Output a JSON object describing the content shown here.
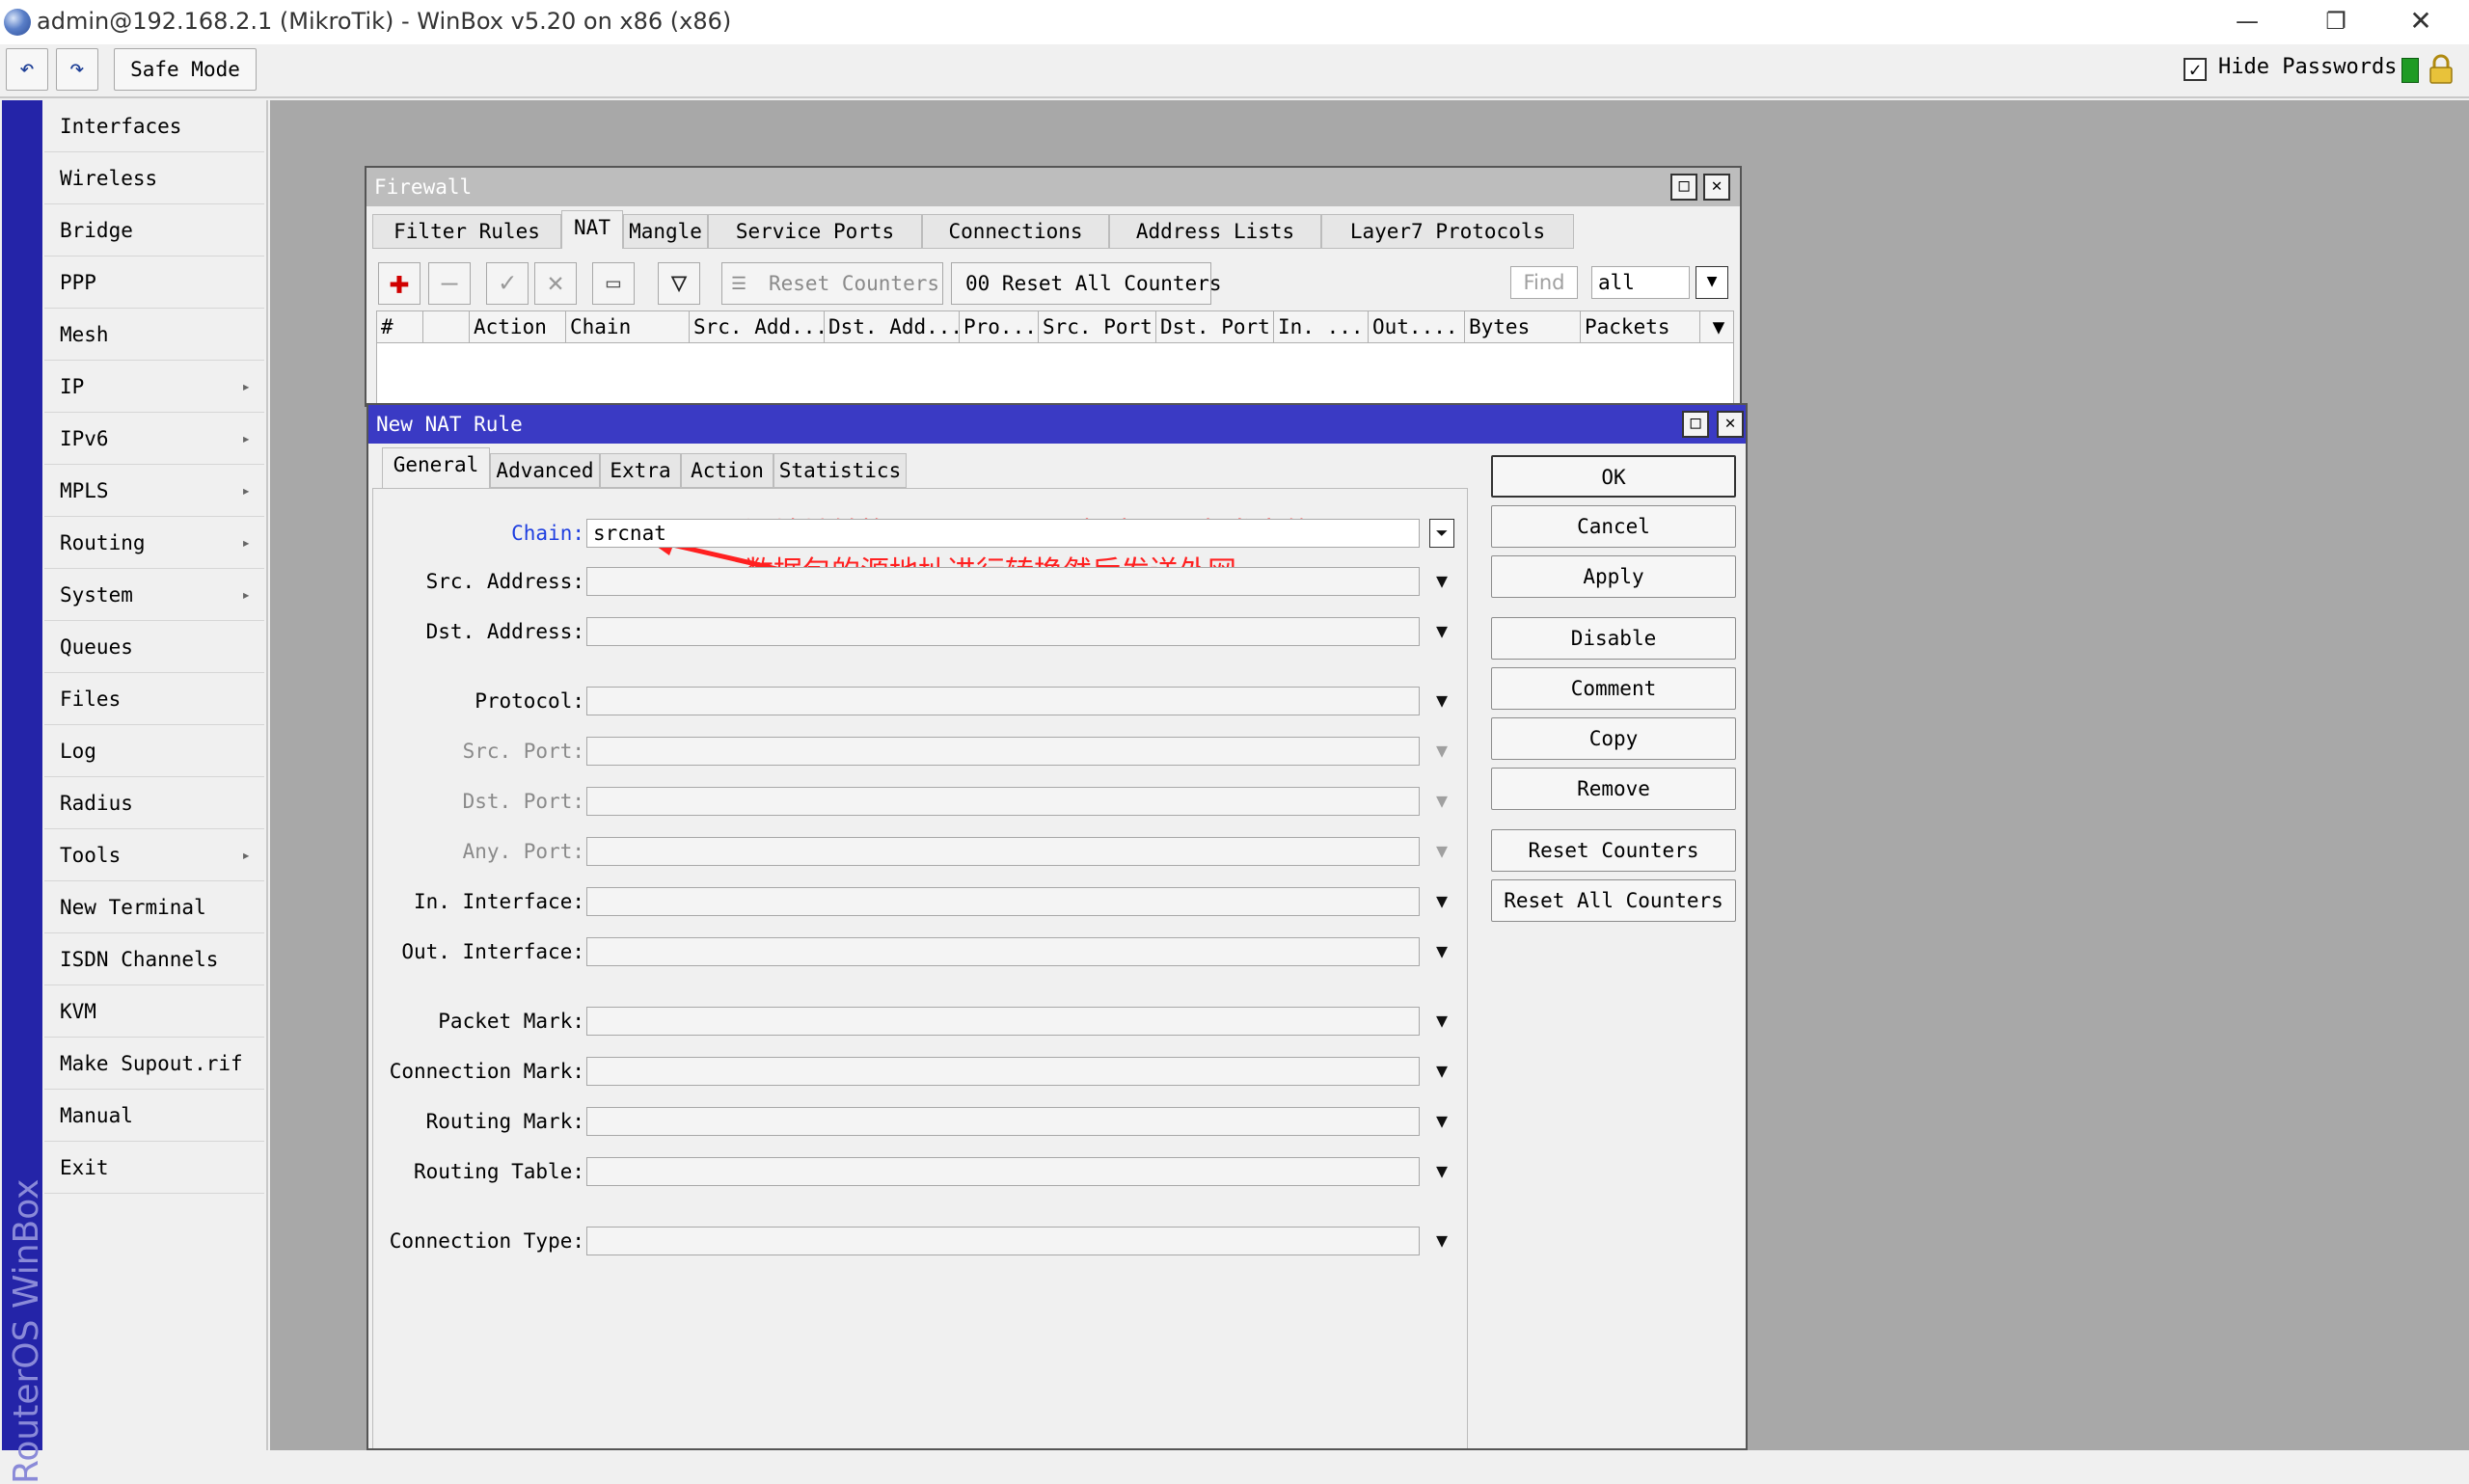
{
  "window": {
    "title": "admin@192.168.2.1 (MikroTik) - WinBox v5.20 on x86 (x86)",
    "minimize_glyph": "—",
    "maximize_glyph": "❐",
    "close_glyph": "✕"
  },
  "toolbar": {
    "undo_icon": "undo-icon",
    "redo_icon": "redo-icon",
    "undo_glyph": "↶",
    "redo_glyph": "↷",
    "safe_mode_label": "Safe Mode",
    "hide_passwords_label": "Hide Passwords",
    "hide_passwords_checked": true,
    "hide_passwords_glyph": "✓"
  },
  "brand": {
    "text": "RouterOS WinBox"
  },
  "menu": {
    "items": [
      {
        "label": "Interfaces",
        "submenu": false
      },
      {
        "label": "Wireless",
        "submenu": false
      },
      {
        "label": "Bridge",
        "submenu": false
      },
      {
        "label": "PPP",
        "submenu": false
      },
      {
        "label": "Mesh",
        "submenu": false
      },
      {
        "label": "IP",
        "submenu": true
      },
      {
        "label": "IPv6",
        "submenu": true
      },
      {
        "label": "MPLS",
        "submenu": true
      },
      {
        "label": "Routing",
        "submenu": true
      },
      {
        "label": "System",
        "submenu": true
      },
      {
        "label": "Queues",
        "submenu": false
      },
      {
        "label": "Files",
        "submenu": false
      },
      {
        "label": "Log",
        "submenu": false
      },
      {
        "label": "Radius",
        "submenu": false
      },
      {
        "label": "Tools",
        "submenu": true
      },
      {
        "label": "New Terminal",
        "submenu": false
      },
      {
        "label": "ISDN Channels",
        "submenu": false
      },
      {
        "label": "KVM",
        "submenu": false
      },
      {
        "label": "Make Supout.rif",
        "submenu": false
      },
      {
        "label": "Manual",
        "submenu": false
      },
      {
        "label": "Exit",
        "submenu": false
      }
    ],
    "submenu_glyph": "▸"
  },
  "firewall": {
    "title": "Firewall",
    "tabs": [
      "Filter Rules",
      "NAT",
      "Mangle",
      "Service Ports",
      "Connections",
      "Address Lists",
      "Layer7 Protocols"
    ],
    "active_tab": "NAT",
    "toolbar": {
      "add_glyph": "✚",
      "remove_glyph": "—",
      "enable_glyph": "✓",
      "disable_glyph": "✕",
      "comment_glyph": "▭",
      "filter_glyph": "▽",
      "reset_counters_icon_glyph": "☰",
      "reset_counters": "Reset Counters",
      "reset_all_counters": "00 Reset All Counters",
      "find_placeholder": "Find",
      "filter_value": "all",
      "filter_drop_glyph": "▼"
    },
    "columns": [
      "#",
      "",
      "Action",
      "Chain",
      "Src. Add...",
      "Dst. Add...",
      "Pro...",
      "Src. Port",
      "Dst. Port",
      "In. ...",
      "Out....",
      "Bytes",
      "Packets"
    ],
    "column_menu_glyph": "▼",
    "rows": []
  },
  "nat_rule": {
    "title": "New NAT Rule",
    "tabs": [
      "General",
      "Advanced",
      "Extra",
      "Action",
      "Statistics"
    ],
    "active_tab": "General",
    "fields": [
      {
        "label": "Chain:",
        "value": "srcnat",
        "enabled": true
      },
      {
        "label": "Src. Address:",
        "value": "",
        "enabled": true
      },
      {
        "label": "Dst. Address:",
        "value": "",
        "enabled": true
      },
      {
        "label": "Protocol:",
        "value": "",
        "enabled": true
      },
      {
        "label": "Src. Port:",
        "value": "",
        "enabled": false
      },
      {
        "label": "Dst. Port:",
        "value": "",
        "enabled": false
      },
      {
        "label": "Any. Port:",
        "value": "",
        "enabled": false
      },
      {
        "label": "In. Interface:",
        "value": "",
        "enabled": true
      },
      {
        "label": "Out. Interface:",
        "value": "",
        "enabled": true
      },
      {
        "label": "Packet Mark:",
        "value": "",
        "enabled": true
      },
      {
        "label": "Connection Mark:",
        "value": "",
        "enabled": true
      },
      {
        "label": "Routing Mark:",
        "value": "",
        "enabled": true
      },
      {
        "label": "Routing Table:",
        "value": "",
        "enabled": true
      },
      {
        "label": "Connection Type:",
        "value": "",
        "enabled": true
      }
    ],
    "drop_glyph": "▼",
    "chain_drop_glyph": "⏷",
    "buttons": [
      "OK",
      "Cancel",
      "Apply",
      "Disable",
      "Comment",
      "Copy",
      "Remove",
      "Reset Counters",
      "Reset All Counters"
    ],
    "annotation": {
      "line1": "源地址转换，scrnat是ros把内网设备发出的",
      "line2": "数据包的源地址进行转换然后发送外网",
      "color": "#ff2020"
    },
    "title_bar_color": "#3a3ac4"
  },
  "colors": {
    "brand_bar": "#2424a8",
    "workspace": "#a8a8a8",
    "panel": "#f0f0f0"
  }
}
